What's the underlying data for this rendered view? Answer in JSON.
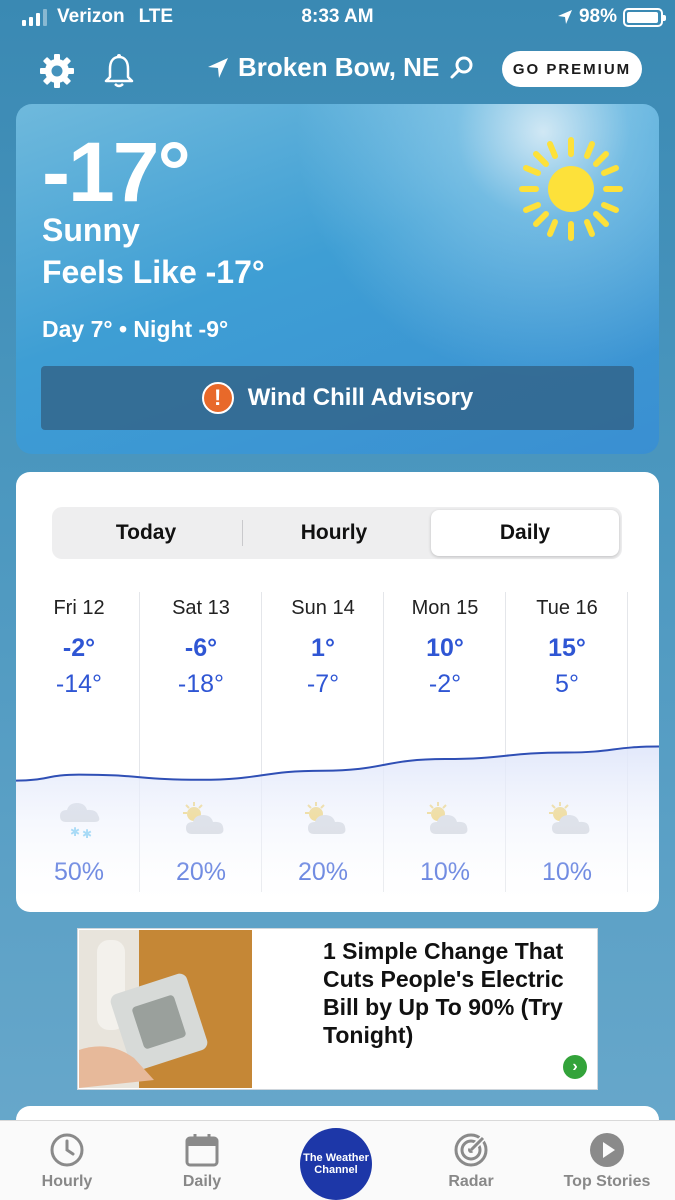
{
  "status_bar": {
    "carrier": "Verizon",
    "network": "LTE",
    "time": "8:33 AM",
    "battery": "98%",
    "battery_level": 0.98
  },
  "header": {
    "location": "Broken Bow, NE",
    "premium_label": "GO PREMIUM",
    "icons": [
      "gear-icon",
      "bell-icon",
      "location-arrow-icon",
      "search-icon"
    ]
  },
  "current": {
    "temperature": "-17°",
    "condition": "Sunny",
    "feels_like": "Feels Like -17°",
    "day_night": "Day 7° • Night -9°",
    "icon": "sun-icon",
    "advisory": "Wind Chill Advisory",
    "advisory_icon": "!"
  },
  "forecast": {
    "tabs": [
      "Today",
      "Hourly",
      "Daily"
    ],
    "active_tab": "Daily",
    "days": [
      {
        "name": "Fri 12",
        "hi": "-2°",
        "lo": "-14°",
        "icon": "snow-cloud-icon",
        "precip": "50%"
      },
      {
        "name": "Sat 13",
        "hi": "-6°",
        "lo": "-18°",
        "icon": "partly-cloudy-icon",
        "precip": "20%"
      },
      {
        "name": "Sun 14",
        "hi": "1°",
        "lo": "-7°",
        "icon": "partly-cloudy-icon",
        "precip": "20%"
      },
      {
        "name": "Mon 15",
        "hi": "10°",
        "lo": "-2°",
        "icon": "partly-cloudy-icon",
        "precip": "10%"
      },
      {
        "name": "Tue 16",
        "hi": "15°",
        "lo": "5°",
        "icon": "partly-cloudy-icon",
        "precip": "10%"
      }
    ],
    "temperature_trend_highs": [
      -2,
      -6,
      1,
      10,
      15
    ]
  },
  "ad": {
    "headline": "1 Simple Change That Cuts People's Electric Bill by Up To 90% (Try Tonight)",
    "go_icon": "›"
  },
  "tabbar": {
    "items": [
      "Hourly",
      "Daily",
      "Radar",
      "Top Stories"
    ],
    "center_logo": "The Weather Channel",
    "colors": {
      "accent": "#2f56d4",
      "logo": "#1d37a8",
      "advisory": "#e8692a"
    }
  }
}
